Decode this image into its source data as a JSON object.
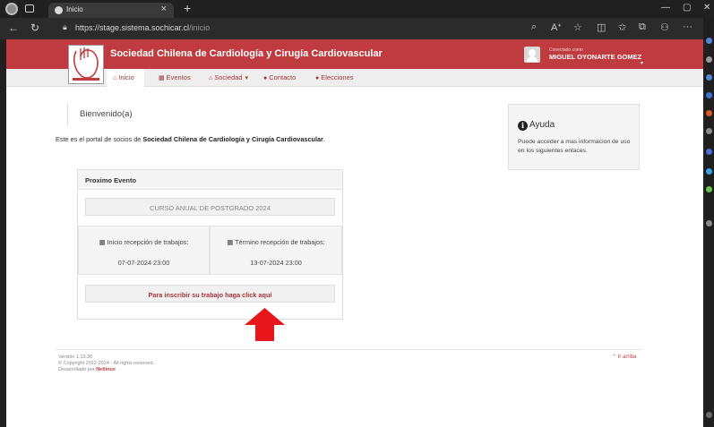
{
  "browser": {
    "tab_title": "Inicio",
    "url_host": "https://stage.sistema.sochicar.cl",
    "url_path": "/inicio",
    "new_tab": "+",
    "tab_close": "×"
  },
  "site": {
    "title": "Sociedad Chilena de Cardiología y Cirugía Cardiovascular",
    "connected_label": "Conectado como",
    "user_name": "MIGUEL OYONARTE GOMEZ"
  },
  "nav": {
    "items": [
      {
        "icon": "home-icon",
        "label": "Inicio"
      },
      {
        "icon": "calendar-icon",
        "label": "Eventos"
      },
      {
        "icon": "bank-icon",
        "label": "Sociedad"
      },
      {
        "icon": "info-icon",
        "label": "Contacto"
      },
      {
        "icon": "info-icon",
        "label": "Elecciones"
      }
    ]
  },
  "main": {
    "welcome": "Bienvenido(a)",
    "intro_prefix": "Este es el portal de socios de ",
    "intro_bold": "Sociedad Chilena de Cardiología y Cirugía Cardiovascular",
    "intro_suffix": "."
  },
  "event": {
    "header": "Proximo Evento",
    "name": "CURSO ANUAL DE POSTGRADO 2024",
    "start_label": "Inicio recepción de trabajos:",
    "start_value": "07-07-2024 23:00",
    "end_label": "Término recepción de trabajos:",
    "end_value": "13-07-2024 23:00",
    "cta": "Para inscribir su trabajo haga click aquí"
  },
  "help": {
    "title": "Ayuda",
    "text": "Puede acceder a mas informacion de uso en los siguientes enlaces."
  },
  "footer": {
    "version": "Versión 1.13.36",
    "copyright": "© Copyright 2012-2024 - All rights reserved.",
    "developer_prefix": "Desarrollado por ",
    "developer": "Netlinux",
    "back_to_top": "Ir arriba"
  },
  "colors": {
    "brand": "#bf3b3f",
    "link": "#a33438",
    "arrow": "#e8151b"
  }
}
